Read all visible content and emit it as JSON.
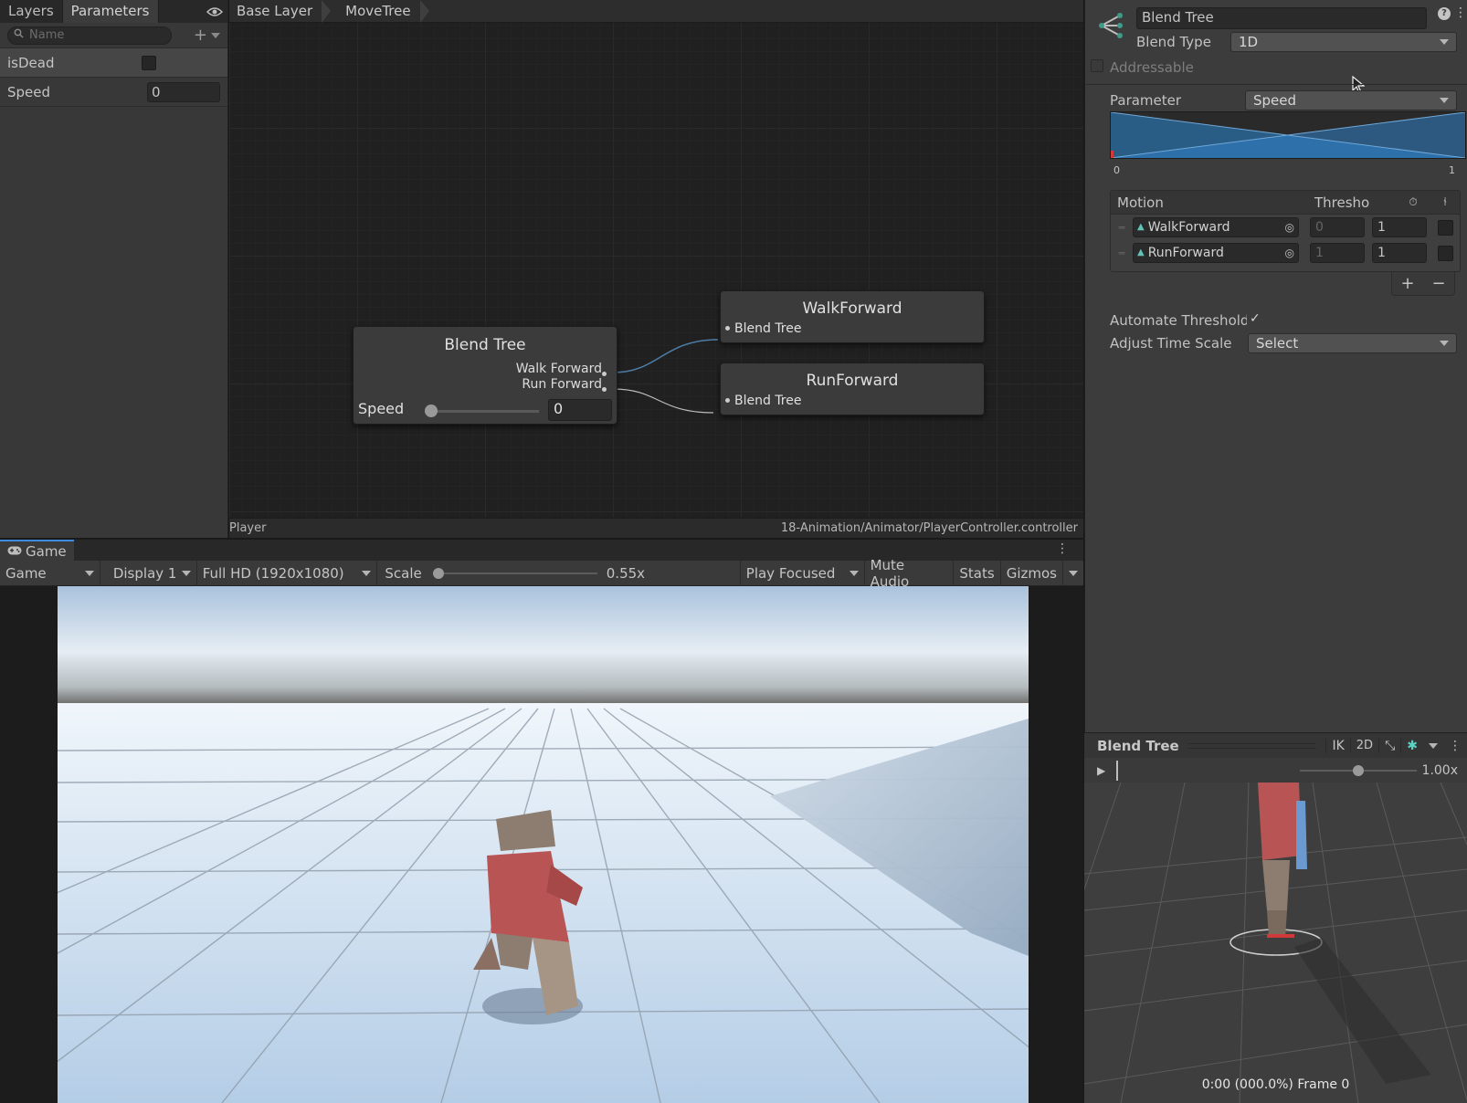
{
  "animator": {
    "tabs": [
      "Layers",
      "Parameters"
    ],
    "search_placeholder": "Name",
    "params": [
      {
        "name": "isDead",
        "type": "bool"
      },
      {
        "name": "Speed",
        "value": "0"
      }
    ],
    "breadcrumbs": [
      "Base Layer",
      "MoveTree"
    ],
    "blend_node": {
      "title": "Blend Tree",
      "outputs": [
        "Walk Forward",
        "Run Forward"
      ],
      "param_label": "Speed",
      "param_value": "0"
    },
    "motion_nodes": [
      {
        "title": "WalkForward",
        "input": "Blend Tree"
      },
      {
        "title": "RunForward",
        "input": "Blend Tree"
      }
    ],
    "status_left": "Player",
    "status_right": "18-Animation/Animator/PlayerController.controller"
  },
  "game": {
    "tab": "Game",
    "toolbar": {
      "view": "Game",
      "display": "Display 1",
      "resolution": "Full HD (1920x1080)",
      "scale_label": "Scale",
      "scale_value": "0.55x",
      "play_mode": "Play Focused",
      "mute": "Mute Audio",
      "stats": "Stats",
      "gizmos": "Gizmos"
    }
  },
  "inspector": {
    "name": "Blend Tree",
    "blend_type_label": "Blend Type",
    "blend_type": "1D",
    "addressable": "Addressable",
    "parameter_label": "Parameter",
    "parameter": "Speed",
    "graph_min": "0",
    "graph_max": "1",
    "motion_header": "Motion",
    "threshold_header": "Thresho",
    "motions": [
      {
        "name": "WalkForward",
        "threshold": "0",
        "speed": "1"
      },
      {
        "name": "RunForward",
        "threshold": "1",
        "speed": "1"
      }
    ],
    "add": "+",
    "remove": "−",
    "automate_label": "Automate Thresholds",
    "automate": true,
    "adjust_label": "Adjust Time Scale",
    "adjust_value": "Select"
  },
  "preview": {
    "title": "Blend Tree",
    "ik": "IK",
    "two_d": "2D",
    "speed": "1.00x",
    "time": "0:00 (000.0%) Frame 0"
  },
  "colors": {
    "graph_bg": "#202020",
    "blend_fill": "#2a6a9c",
    "accent": "#2f80c8"
  }
}
